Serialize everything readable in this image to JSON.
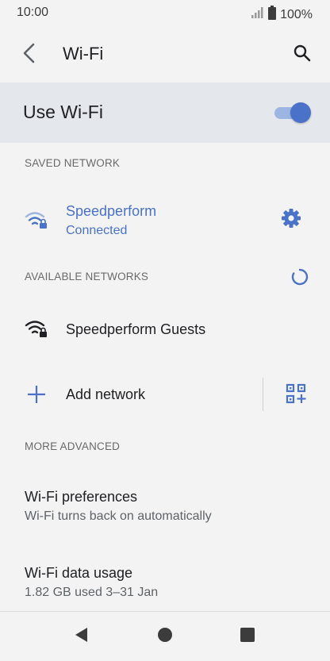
{
  "status": {
    "time": "10:00",
    "battery": "100%"
  },
  "header": {
    "title": "Wi-Fi"
  },
  "master": {
    "label": "Use Wi-Fi",
    "enabled": true
  },
  "sections": {
    "saved": "SAVED NETWORK",
    "available": "AVAILABLE NETWORKS",
    "advanced": "MORE ADVANCED"
  },
  "saved_network": {
    "name": "Speedperform",
    "status": "Connected"
  },
  "available_networks": [
    {
      "name": "Speedperform Guests"
    }
  ],
  "add_network": {
    "label": "Add network"
  },
  "preferences": [
    {
      "title": "Wi-Fi preferences",
      "subtitle": "Wi-Fi turns back on automatically"
    },
    {
      "title": "Wi-Fi data usage",
      "subtitle": "1.82 GB used 3–31 Jan"
    }
  ],
  "colors": {
    "accent": "#4a72c8",
    "background": "#f3f3f3",
    "highlight": "#e4e7ec"
  },
  "icons": [
    "back-arrow-icon",
    "search-icon",
    "wifi-lock-icon",
    "gear-icon",
    "refresh-icon",
    "plus-icon",
    "qr-code-icon",
    "nav-back-icon",
    "nav-home-icon",
    "nav-recents-icon",
    "signal-icon",
    "battery-icon"
  ]
}
